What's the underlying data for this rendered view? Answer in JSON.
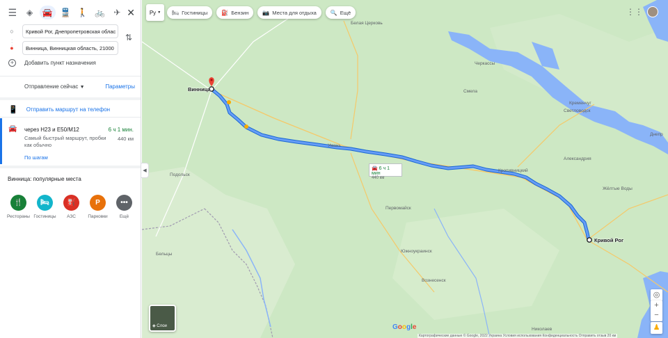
{
  "panel": {
    "modes": [
      "menu-icon",
      "best-mode-icon",
      "car-icon",
      "transit-icon",
      "walk-icon",
      "bike-icon",
      "plane-icon"
    ],
    "origin": "Кривой Рог, Днепропетровская облас",
    "destination": "Винница, Винницкая область, 21000",
    "add_destination": "Добавить пункт назначения",
    "departure": "Отправление сейчас",
    "parameters": "Параметры",
    "send_to_phone": "Отправить маршрут на телефон",
    "route": {
      "via": "через Н23 и E50/M12",
      "time": "6 ч 1 мин.",
      "description": "Самый быстрый маршрут, пробки как обычно",
      "distance": "440 км",
      "steps": "По шагам"
    },
    "popular_title": "Винница: популярные места",
    "categories": [
      {
        "label": "Рестораны",
        "icon": "utensils-icon",
        "glyph": "🍴",
        "color": "#188038"
      },
      {
        "label": "Гостиницы",
        "icon": "bed-icon",
        "glyph": "🛏",
        "color": "#12b5cb"
      },
      {
        "label": "АЗС",
        "icon": "gas-icon",
        "glyph": "⛽",
        "color": "#d93025"
      },
      {
        "label": "Парковки",
        "icon": "parking-icon",
        "glyph": "P",
        "color": "#e8710a"
      },
      {
        "label": "Ещё",
        "icon": "more-icon",
        "glyph": "•••",
        "color": "#5f6368"
      }
    ]
  },
  "map": {
    "lang_button": "Ру",
    "chips": [
      {
        "label": "Гостиницы",
        "icon": "bed-icon"
      },
      {
        "label": "Бензин",
        "icon": "gas-icon"
      },
      {
        "label": "Места для отдыха",
        "icon": "camera-icon"
      },
      {
        "label": "Ещё",
        "icon": "search-icon"
      }
    ],
    "route_time": "6 ч 1 мин",
    "route_distance": "440 км",
    "start_label": "Кривой Рог",
    "end_label": "Винница",
    "labels": [
      "Белая Церковь",
      "Черкассы",
      "Смела",
      "Кременчуг",
      "Светловодск",
      "Умань",
      "Кропивницкий",
      "Александрия",
      "Первомайск",
      "Вознесенск",
      "Южноукраинск",
      "Жёлтые Воды",
      "Подольск",
      "Бельцы",
      "Днепр",
      "Николаев"
    ],
    "layers_label": "Слои",
    "footer": "Картографические данные © Google, 2022   Украина   Условия использования   Конфиденциальность   Отправить отзыв   20 км",
    "colors": {
      "route": "#4a80f5",
      "water": "#8ab4f8",
      "land": "#cde8c4"
    }
  }
}
